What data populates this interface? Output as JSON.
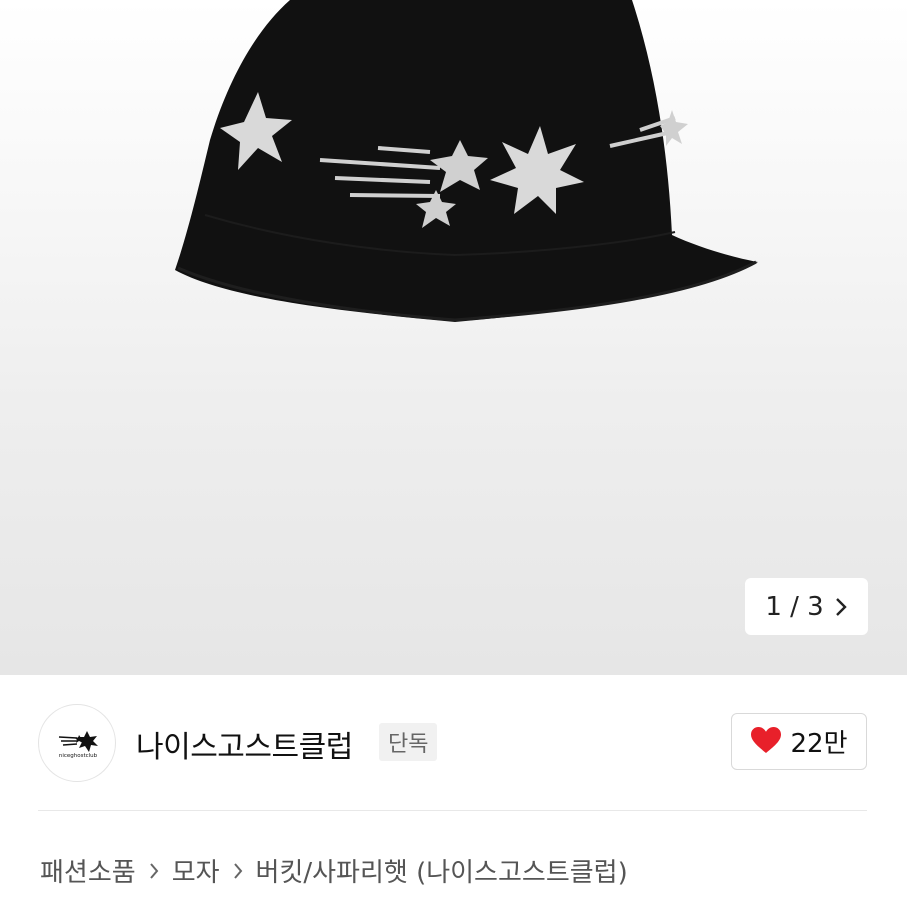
{
  "gallery": {
    "product_image": "black knit bucket hat with white star pattern",
    "counter": "1 / 3",
    "next_icon": "chevron-right-icon"
  },
  "seller": {
    "logo_icon": "niceghostclub-logo",
    "logo_text": "niceghostclub",
    "brand_name": "나이스고스트클럽",
    "badge": "단독"
  },
  "like": {
    "icon": "heart-icon",
    "count": "22만",
    "heart_color": "#e8202a"
  },
  "breadcrumb": {
    "items": [
      "패션소품",
      "모자",
      "버킷/사파리햇 (나이스고스트클럽)"
    ],
    "separator_icon": "chevron-right-icon"
  }
}
